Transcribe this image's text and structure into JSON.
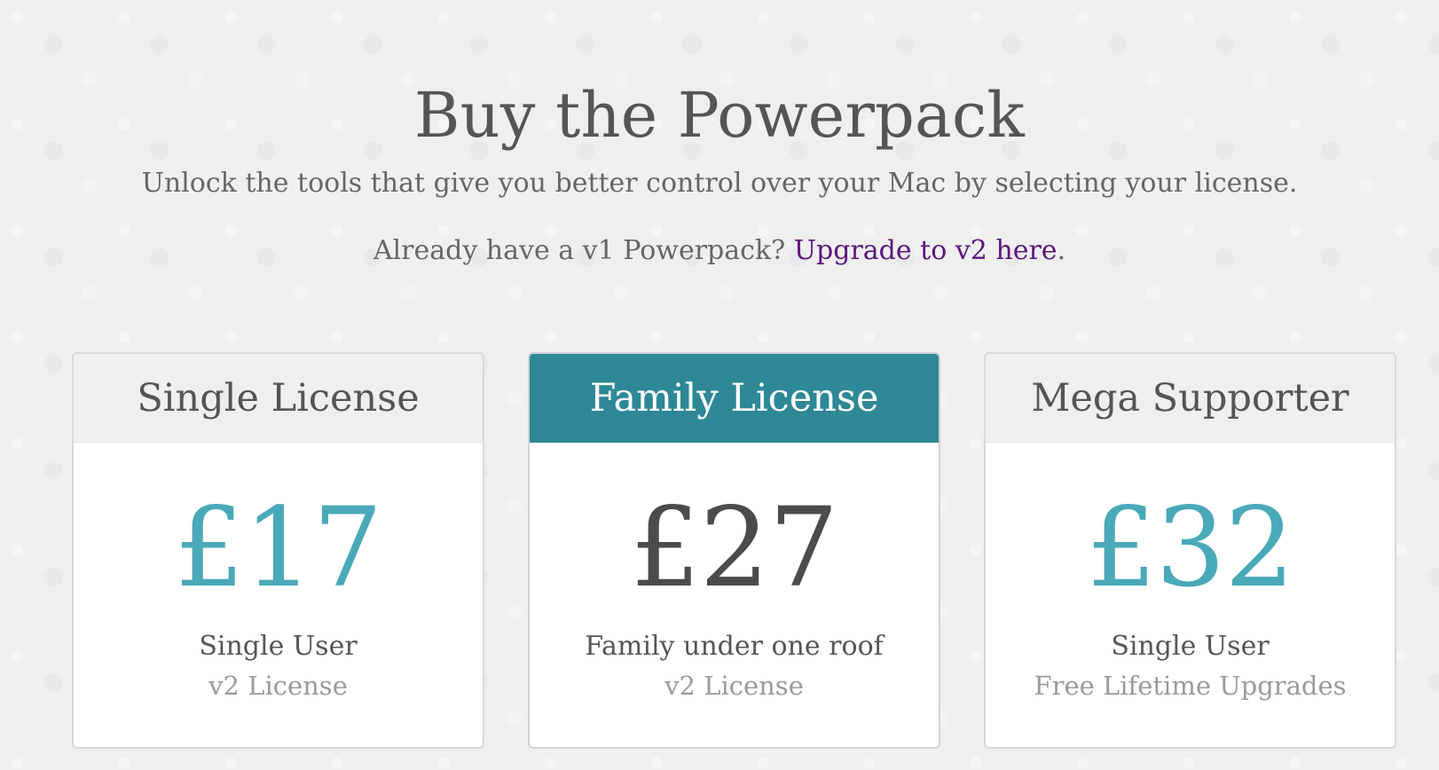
{
  "header": {
    "title": "Buy the Powerpack",
    "subtitle": "Unlock the tools that give you better control over your Mac by selecting your license.",
    "upgrade_prefix": "Already have a v1 Powerpack? ",
    "upgrade_link": "Upgrade to v2 here",
    "upgrade_suffix": "."
  },
  "cards": [
    {
      "title": "Single License",
      "price": "£17",
      "line1": "Single User",
      "line2": "v2 License"
    },
    {
      "title": "Family License",
      "price": "£27",
      "line1": "Family under one roof",
      "line2": "v2 License"
    },
    {
      "title": "Mega Supporter",
      "price": "£32",
      "line1": "Single User",
      "line2": "Free Lifetime Upgrades"
    }
  ],
  "colors": {
    "accent": "#2e8896",
    "price_teal": "#49a9b9",
    "link": "#5b167c"
  }
}
